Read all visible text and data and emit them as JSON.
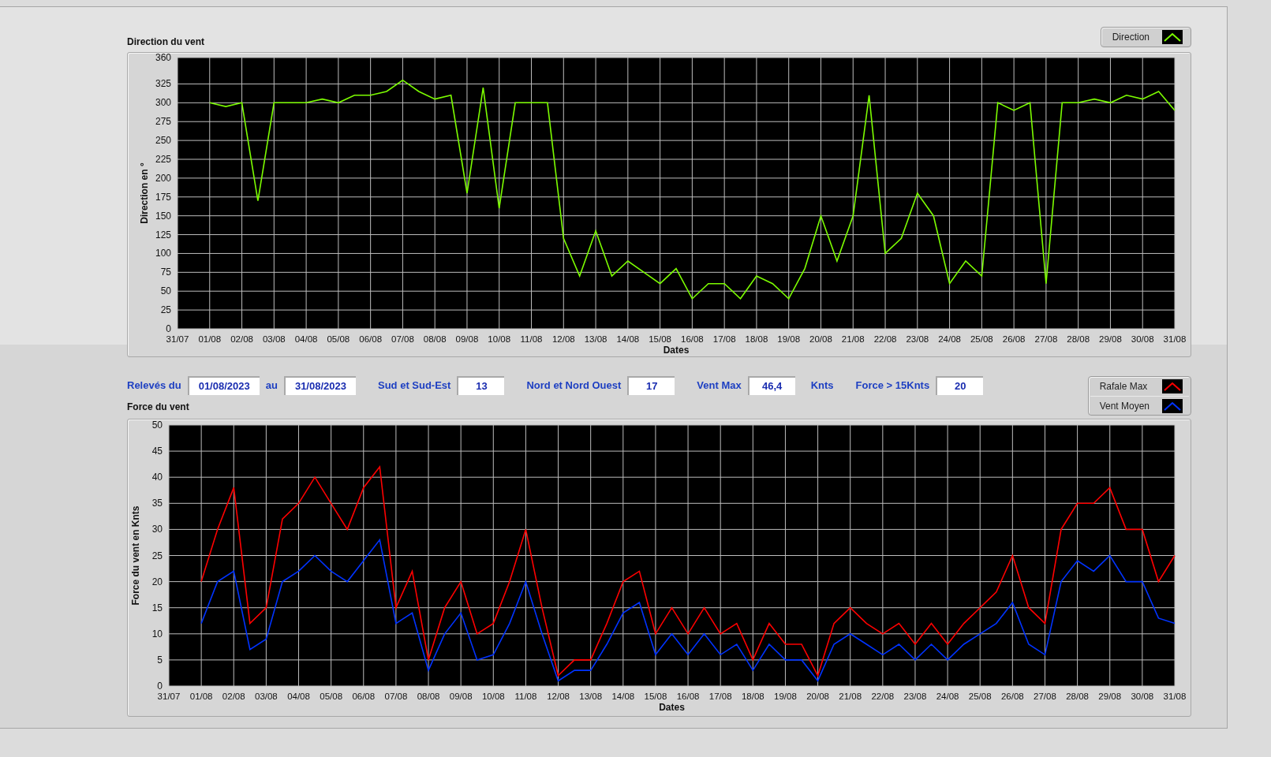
{
  "direction_chart": {
    "title": "Direction du vent",
    "chart_data": {
      "type": "line",
      "xlabel": "Dates",
      "ylabel": "Direction en °",
      "grid": true,
      "ylim": [
        0,
        360
      ],
      "yticks": [
        0,
        25,
        50,
        75,
        100,
        125,
        150,
        175,
        200,
        225,
        250,
        275,
        300,
        325,
        360
      ],
      "categories": [
        "31/07",
        null,
        "01/08",
        null,
        "02/08",
        null,
        "03/08",
        null,
        "04/08",
        null,
        "05/08",
        null,
        "06/08",
        null,
        "07/08",
        null,
        "08/08",
        null,
        "09/08",
        null,
        "10/08",
        null,
        "11/08",
        null,
        "12/08",
        null,
        "13/08",
        null,
        "14/08",
        null,
        "15/08",
        null,
        "16/08",
        null,
        "17/08",
        null,
        "18/08",
        null,
        "19/08",
        null,
        "20/08",
        null,
        "21/08",
        null,
        "22/08",
        null,
        "23/08",
        null,
        "24/08",
        null,
        "25/08",
        null,
        "26/08",
        null,
        "27/08",
        null,
        "28/08",
        null,
        "29/08",
        null,
        "30/08",
        null,
        "31/08"
      ],
      "series": [
        {
          "name": "Direction",
          "color": "#7cfc00",
          "values": [
            null,
            null,
            300,
            295,
            300,
            170,
            300,
            300,
            300,
            305,
            300,
            310,
            310,
            315,
            330,
            315,
            305,
            310,
            180,
            320,
            160,
            300,
            300,
            300,
            120,
            70,
            130,
            70,
            90,
            75,
            60,
            80,
            40,
            60,
            60,
            40,
            70,
            60,
            40,
            80,
            150,
            90,
            150,
            310,
            100,
            120,
            180,
            150,
            60,
            90,
            70,
            300,
            290,
            300,
            60,
            300,
            300,
            305,
            300,
            310,
            305,
            315,
            290
          ]
        }
      ]
    }
  },
  "controls": [
    {
      "label": "Relevés du",
      "value": "01/08/2023"
    },
    {
      "label": "au",
      "value": "31/08/2023"
    },
    {
      "label": "Sud et Sud-Est",
      "value": "13"
    },
    {
      "label": "Nord et Nord Ouest",
      "value": "17"
    },
    {
      "label": "Vent Max",
      "value": "46,4",
      "unit": "Knts"
    },
    {
      "label": "Force > 15Knts",
      "value": "20"
    }
  ],
  "force_chart": {
    "title": "Force du vent",
    "chart_data": {
      "type": "line",
      "xlabel": "Dates",
      "ylabel": "Force du vent en Knts",
      "grid": true,
      "ylim": [
        0,
        50
      ],
      "yticks": [
        0,
        5,
        10,
        15,
        20,
        25,
        30,
        35,
        40,
        45,
        50
      ],
      "categories": [
        "31/07",
        null,
        "01/08",
        null,
        "02/08",
        null,
        "03/08",
        null,
        "04/08",
        null,
        "05/08",
        null,
        "06/08",
        null,
        "07/08",
        null,
        "08/08",
        null,
        "09/08",
        null,
        "10/08",
        null,
        "11/08",
        null,
        "12/08",
        null,
        "13/08",
        null,
        "14/08",
        null,
        "15/08",
        null,
        "16/08",
        null,
        "17/08",
        null,
        "18/08",
        null,
        "19/08",
        null,
        "20/08",
        null,
        "21/08",
        null,
        "22/08",
        null,
        "23/08",
        null,
        "24/08",
        null,
        "25/08",
        null,
        "26/08",
        null,
        "27/08",
        null,
        "28/08",
        null,
        "29/08",
        null,
        "30/08",
        null,
        "31/08"
      ],
      "series": [
        {
          "name": "Rafale Max",
          "color": "#ff0000",
          "values": [
            null,
            null,
            20,
            30,
            38,
            12,
            15,
            32,
            35,
            40,
            35,
            30,
            38,
            42,
            15,
            22,
            5,
            15,
            20,
            10,
            12,
            20,
            30,
            15,
            2,
            5,
            5,
            12,
            20,
            22,
            10,
            15,
            10,
            15,
            10,
            12,
            5,
            12,
            8,
            8,
            2,
            12,
            15,
            12,
            10,
            12,
            8,
            12,
            8,
            12,
            15,
            18,
            25,
            15,
            12,
            30,
            35,
            35,
            38,
            30,
            30,
            20,
            25
          ]
        },
        {
          "name": "Vent Moyen",
          "color": "#0033ff",
          "values": [
            null,
            null,
            12,
            20,
            22,
            7,
            9,
            20,
            22,
            25,
            22,
            20,
            24,
            28,
            12,
            14,
            3,
            10,
            14,
            5,
            6,
            12,
            20,
            10,
            1,
            3,
            3,
            8,
            14,
            16,
            6,
            10,
            6,
            10,
            6,
            8,
            3,
            8,
            5,
            5,
            1,
            8,
            10,
            8,
            6,
            8,
            5,
            8,
            5,
            8,
            10,
            12,
            16,
            8,
            6,
            20,
            24,
            22,
            25,
            20,
            20,
            13,
            12
          ]
        }
      ]
    }
  }
}
